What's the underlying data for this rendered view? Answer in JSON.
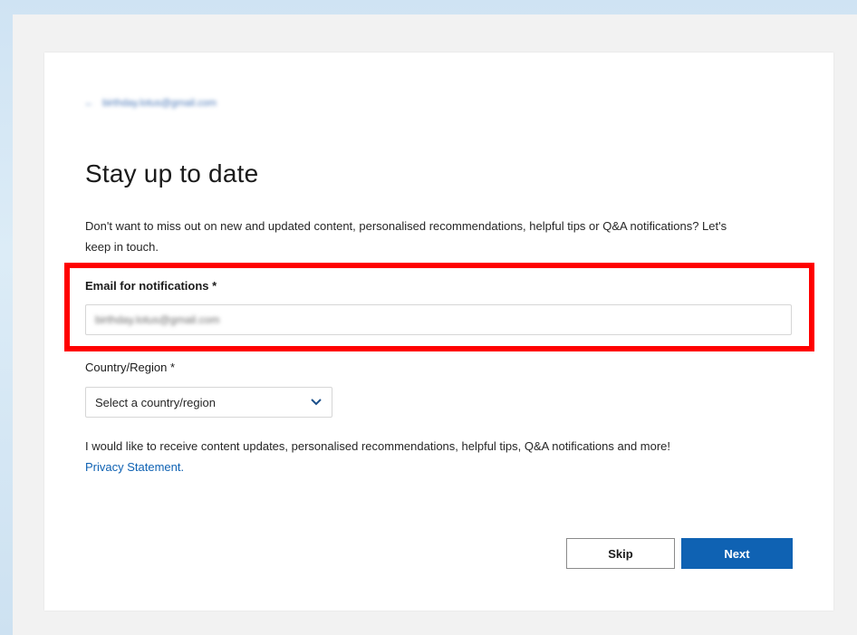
{
  "account": {
    "back_glyph": "←",
    "email": "birthday.lotus@gmail.com"
  },
  "page": {
    "title": "Stay up to date",
    "description": "Don't want to miss out on new and updated content, personalised recommendations, helpful tips or Q&A notifications? Let's keep in touch."
  },
  "email_field": {
    "label": "Email for notifications *",
    "value": "birthday.lotus@gmail.com"
  },
  "country_field": {
    "label": "Country/Region *",
    "selected": "Select a country/region"
  },
  "consent": {
    "text": "I would like to receive content updates, personalised recommendations, helpful tips, Q&A notifications and more!",
    "privacy_link": "Privacy Statement."
  },
  "buttons": {
    "skip": "Skip",
    "next": "Next"
  },
  "colors": {
    "accent": "#0f62b3",
    "highlight": "#ff0000",
    "background": "#f2f2f2"
  },
  "icons": {
    "dropdown": "chevron-down-icon",
    "back": "back-arrow-icon"
  }
}
